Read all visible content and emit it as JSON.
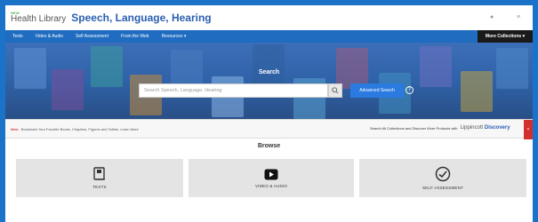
{
  "header": {
    "brand_new": "NEW",
    "brand_name": "Health Library",
    "site_title": "Speech, Language, Hearing",
    "icons": [
      "user-icon",
      "menu-icon"
    ]
  },
  "nav": {
    "items": [
      "Texts",
      "Video & Audio",
      "Self Assessment",
      "From the Web",
      "Resources ▾"
    ],
    "more": "More Collections ▾"
  },
  "hero": {
    "title": "Search",
    "search_placeholder": "Search Speech, Language, Hearing",
    "advanced_label": "Advanced Search",
    "help_label": "?"
  },
  "promo": {
    "new_label": "New",
    "text": " - Bookmark Your Favorite Books, Chapters, Figures and Tables. Learn More",
    "right_text": "Search All Collections and Discover More Products with",
    "logo_left": "Lippincott",
    "logo_right": "Discovery",
    "close": "×"
  },
  "browse": {
    "title": "Browse",
    "cards": [
      {
        "label": "TEXTS",
        "icon": "book-icon"
      },
      {
        "label": "VIDEO & AUDIO",
        "icon": "play-icon"
      },
      {
        "label": "SELF ASSESSMENT",
        "icon": "check-circle-icon"
      }
    ]
  },
  "colors": {
    "primary": "#1f6cc0",
    "accent": "#2a7ae0",
    "more_bg": "#1a1a1a",
    "promo_close": "#d32f2f"
  }
}
